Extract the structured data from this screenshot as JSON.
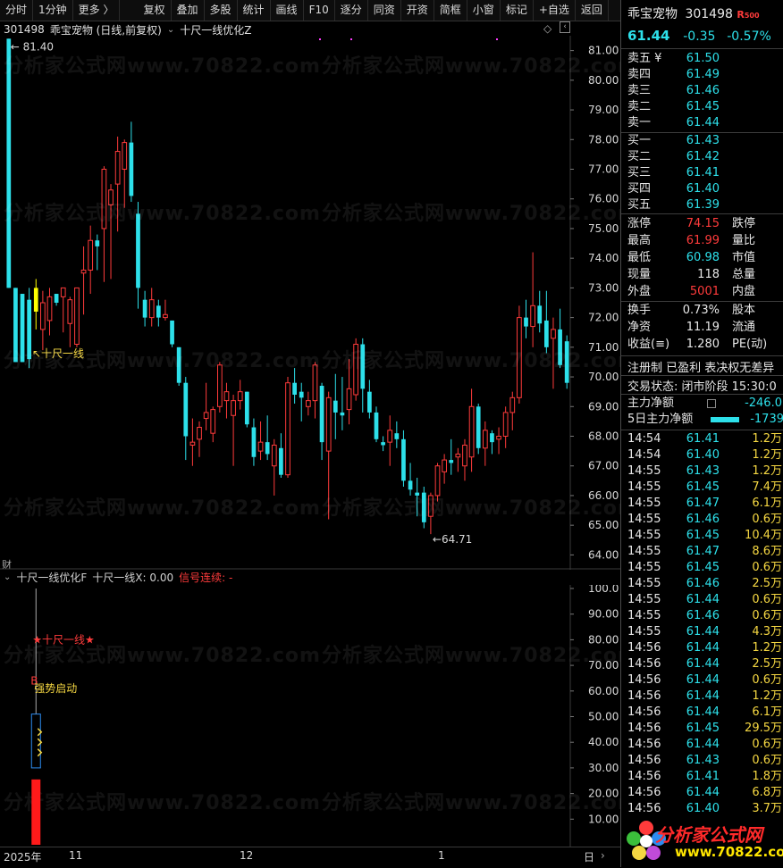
{
  "toolbar": {
    "items": [
      "分时",
      "1分钟",
      "更多 〉",
      "复权",
      "叠加",
      "多股",
      "统计",
      "画线",
      "F10",
      "逐分",
      "同资",
      "开资",
      "简框",
      "小窗",
      "标记",
      "+自选",
      "返回"
    ]
  },
  "chart": {
    "code": "301498",
    "name_period": "乖宝宠物 (日线,前复权)",
    "indicator_name": "十尺一线优化Z",
    "y_axis": [
      "81.00",
      "80.00",
      "79.00",
      "78.00",
      "77.00",
      "76.00",
      "75.00",
      "74.00",
      "73.00",
      "72.00",
      "71.00",
      "70.00",
      "69.00",
      "68.00",
      "67.00",
      "66.00",
      "65.00",
      "64.00"
    ],
    "high_marker": "81.40",
    "low_marker": "64.71",
    "annotation": "↖十尺一线",
    "fin_tag": "财"
  },
  "indicator": {
    "name": "十尺一线优化F",
    "x_label": "十尺一线X: 0.00",
    "signal_label": "信号连续: -",
    "y_axis": [
      "100.0",
      "90.00",
      "80.00",
      "70.00",
      "60.00",
      "50.00",
      "40.00",
      "30.00",
      "20.00",
      "10.00"
    ],
    "star_text": "★十尺一线★",
    "b_text": "B",
    "start_text": "强势启动"
  },
  "dates": {
    "labels": [
      "2025年",
      "11",
      "12",
      "1"
    ],
    "right_tag": "日"
  },
  "chart_data": {
    "type": "candlestick",
    "ylim": [
      63.5,
      81.5
    ],
    "up_color": "#ff3b3b",
    "down_color": "#2de0ea",
    "signal_color": "#ffff00",
    "candles": [
      [
        81.4,
        81.4,
        73.0,
        73.0
      ],
      [
        73.0,
        73.0,
        70.5,
        70.5
      ],
      [
        72.8,
        72.8,
        70.5,
        70.5
      ],
      [
        72.6,
        73.0,
        70.3,
        70.6
      ],
      [
        72.2,
        73.3,
        71.6,
        73.0
      ],
      [
        71.6,
        72.9,
        70.9,
        72.5
      ],
      [
        71.9,
        73.0,
        71.4,
        72.7
      ],
      [
        72.8,
        72.8,
        72.4,
        72.5
      ],
      [
        72.7,
        73.0,
        71.5,
        73.0
      ],
      [
        71.8,
        72.7,
        71.0,
        72.6
      ],
      [
        71.1,
        73.0,
        71.0,
        73.0
      ],
      [
        73.5,
        74.4,
        72.1,
        73.6
      ],
      [
        73.6,
        75.1,
        72.8,
        74.6
      ],
      [
        74.6,
        74.8,
        73.6,
        74.4
      ],
      [
        75.0,
        77.1,
        73.2,
        77.0
      ],
      [
        75.8,
        76.5,
        73.3,
        76.3
      ],
      [
        76.5,
        78.1,
        74.9,
        77.6
      ],
      [
        77.0,
        78.0,
        75.7,
        77.9
      ],
      [
        77.9,
        78.6,
        75.9,
        76.1
      ],
      [
        75.5,
        75.9,
        72.3,
        73.0
      ],
      [
        72.6,
        72.9,
        71.7,
        72.0
      ],
      [
        72.0,
        73.0,
        71.7,
        72.6
      ],
      [
        72.4,
        72.6,
        71.7,
        72.0
      ],
      [
        72.0,
        72.6,
        71.9,
        72.1
      ],
      [
        71.9,
        71.9,
        71.0,
        71.1
      ],
      [
        71.0,
        71.0,
        69.7,
        69.8
      ],
      [
        69.8,
        70.0,
        67.2,
        68.0
      ],
      [
        67.7,
        68.6,
        67.0,
        67.8
      ],
      [
        67.9,
        68.5,
        67.3,
        68.3
      ],
      [
        68.6,
        69.8,
        68.2,
        68.8
      ],
      [
        68.1,
        69.0,
        67.8,
        68.9
      ],
      [
        69.0,
        70.5,
        68.8,
        70.4
      ],
      [
        69.2,
        69.8,
        68.6,
        69.5
      ],
      [
        68.7,
        69.4,
        67.0,
        69.2
      ],
      [
        69.2,
        69.9,
        68.9,
        69.5
      ],
      [
        69.5,
        69.5,
        68.3,
        68.4
      ],
      [
        68.3,
        68.6,
        67.0,
        67.3
      ],
      [
        67.5,
        68.5,
        67.2,
        67.8
      ],
      [
        67.8,
        68.7,
        67.2,
        67.4
      ],
      [
        67.0,
        67.9,
        66.0,
        67.7
      ],
      [
        67.6,
        68.1,
        66.6,
        66.7
      ],
      [
        66.7,
        70.0,
        66.6,
        69.8
      ],
      [
        69.8,
        70.3,
        69.1,
        69.4
      ],
      [
        69.5,
        69.8,
        68.5,
        69.3
      ],
      [
        69.0,
        69.5,
        68.7,
        69.2
      ],
      [
        69.2,
        70.5,
        68.6,
        70.4
      ],
      [
        69.7,
        69.8,
        67.2,
        67.8
      ],
      [
        67.5,
        69.5,
        65.2,
        69.3
      ],
      [
        69.2,
        70.1,
        67.9,
        68.8
      ],
      [
        68.8,
        70.0,
        68.2,
        68.7
      ],
      [
        68.9,
        70.6,
        68.4,
        69.6
      ],
      [
        69.4,
        71.3,
        69.2,
        71.1
      ],
      [
        71.1,
        71.3,
        68.8,
        69.6
      ],
      [
        69.5,
        69.9,
        68.6,
        68.8
      ],
      [
        68.8,
        69.0,
        67.8,
        67.9
      ],
      [
        67.8,
        68.0,
        67.5,
        67.7
      ],
      [
        67.8,
        68.7,
        67.0,
        68.2
      ],
      [
        68.1,
        68.5,
        67.6,
        67.9
      ],
      [
        67.9,
        68.2,
        66.3,
        66.5
      ],
      [
        66.5,
        67.1,
        66.0,
        66.2
      ],
      [
        66.1,
        66.6,
        65.3,
        66.0
      ],
      [
        66.1,
        66.3,
        64.9,
        65.1
      ],
      [
        65.3,
        66.1,
        64.7,
        66.0
      ],
      [
        66.0,
        67.1,
        65.8,
        67.0
      ],
      [
        66.8,
        67.4,
        66.4,
        67.2
      ],
      [
        67.2,
        67.9,
        66.7,
        67.1
      ],
      [
        67.3,
        67.6,
        66.8,
        67.4
      ],
      [
        67.0,
        67.9,
        66.5,
        67.7
      ],
      [
        67.3,
        69.6,
        66.8,
        69.0
      ],
      [
        69.0,
        69.1,
        67.4,
        67.6
      ],
      [
        67.6,
        68.5,
        67.0,
        68.2
      ],
      [
        68.1,
        68.2,
        67.4,
        67.8
      ],
      [
        67.9,
        68.3,
        67.4,
        68.0
      ],
      [
        68.0,
        69.0,
        67.6,
        68.8
      ],
      [
        68.8,
        69.5,
        68.2,
        69.3
      ],
      [
        69.3,
        72.4,
        69.1,
        72.0
      ],
      [
        72.0,
        72.6,
        71.3,
        71.7
      ],
      [
        71.7,
        74.2,
        71.0,
        72.4
      ],
      [
        72.4,
        72.9,
        71.5,
        71.8
      ],
      [
        71.9,
        72.9,
        70.8,
        71.0
      ],
      [
        71.3,
        72.0,
        69.6,
        71.6
      ],
      [
        71.6,
        72.3,
        70.3,
        70.4
      ],
      [
        71.2,
        71.4,
        69.6,
        69.8
      ]
    ],
    "indicator_bars": {
      "outline_band": [
        30.0,
        51.0
      ],
      "red_column": [
        0,
        25.5
      ],
      "yellow_marks": [
        36,
        40,
        44
      ]
    }
  },
  "side": {
    "title_name": "乖宝宠物",
    "title_code": "301498",
    "title_badge": "R",
    "title_badge_sub": "500",
    "price": "61.44",
    "change": "-0.35",
    "change_pct": "-0.57%",
    "sells": [
      {
        "label": "卖五 ¥",
        "price": "61.50"
      },
      {
        "label": "卖四",
        "price": "61.49"
      },
      {
        "label": "卖三",
        "price": "61.46"
      },
      {
        "label": "卖二",
        "price": "61.45"
      },
      {
        "label": "卖一",
        "price": "61.44"
      }
    ],
    "buys": [
      {
        "label": "买一",
        "price": "61.43"
      },
      {
        "label": "买二",
        "price": "61.42"
      },
      {
        "label": "买三",
        "price": "61.41"
      },
      {
        "label": "买四",
        "price": "61.40"
      },
      {
        "label": "买五",
        "price": "61.39"
      }
    ],
    "stats": [
      {
        "k1": "涨停",
        "v1": "74.15",
        "c1": "red",
        "k2": "跌停"
      },
      {
        "k1": "最高",
        "v1": "61.99",
        "c1": "red",
        "k2": "量比"
      },
      {
        "k1": "最低",
        "v1": "60.98",
        "c1": "cyan",
        "k2": "市值"
      },
      {
        "k1": "现量",
        "v1": "118",
        "c1": "white",
        "k2": "总量"
      },
      {
        "k1": "外盘",
        "v1": "5001",
        "c1": "red",
        "k2": "内盘"
      }
    ],
    "stats2": [
      {
        "k1": "换手",
        "v1": "0.73%",
        "k2": "股本"
      },
      {
        "k1": "净资",
        "v1": "11.19",
        "k2": "流通"
      },
      {
        "k1": "收益(≡)",
        "v1": "1.280",
        "k2": "PE(动)"
      }
    ],
    "flags": "注册制 已盈利 表决权无差异",
    "trade_status": "交易状态: 闭市阶段 15:30:0",
    "main_flow_label": "主力净额",
    "main_flow_value": "-246.0",
    "five_day_label": "5日主力净额",
    "five_day_value": "-1739",
    "ticks": [
      {
        "t": "14:54",
        "p": "61.41",
        "v": "1.2万"
      },
      {
        "t": "14:54",
        "p": "61.40",
        "v": "1.2万"
      },
      {
        "t": "14:55",
        "p": "61.43",
        "v": "1.2万"
      },
      {
        "t": "14:55",
        "p": "61.45",
        "v": "7.4万"
      },
      {
        "t": "14:55",
        "p": "61.47",
        "v": "6.1万"
      },
      {
        "t": "14:55",
        "p": "61.46",
        "v": "0.6万"
      },
      {
        "t": "14:55",
        "p": "61.45",
        "v": "10.4万"
      },
      {
        "t": "14:55",
        "p": "61.47",
        "v": "8.6万"
      },
      {
        "t": "14:55",
        "p": "61.45",
        "v": "0.6万"
      },
      {
        "t": "14:55",
        "p": "61.46",
        "v": "2.5万"
      },
      {
        "t": "14:55",
        "p": "61.44",
        "v": "0.6万"
      },
      {
        "t": "14:55",
        "p": "61.46",
        "v": "0.6万"
      },
      {
        "t": "14:55",
        "p": "61.44",
        "v": "4.3万"
      },
      {
        "t": "14:56",
        "p": "61.44",
        "v": "1.2万"
      },
      {
        "t": "14:56",
        "p": "61.44",
        "v": "2.5万"
      },
      {
        "t": "14:56",
        "p": "61.44",
        "v": "0.6万"
      },
      {
        "t": "14:56",
        "p": "61.44",
        "v": "1.2万"
      },
      {
        "t": "14:56",
        "p": "61.44",
        "v": "6.1万"
      },
      {
        "t": "14:56",
        "p": "61.45",
        "v": "29.5万"
      },
      {
        "t": "14:56",
        "p": "61.44",
        "v": "0.6万"
      },
      {
        "t": "14:56",
        "p": "61.43",
        "v": "0.6万"
      },
      {
        "t": "14:56",
        "p": "61.41",
        "v": "1.8万"
      },
      {
        "t": "14:56",
        "p": "61.44",
        "v": "6.8万"
      },
      {
        "t": "14:56",
        "p": "61.40",
        "v": "3.7万"
      }
    ],
    "logo_text": "分析家公式网",
    "logo_url": "www.70822.com"
  },
  "watermark": "分析家公式网www.70822.com"
}
